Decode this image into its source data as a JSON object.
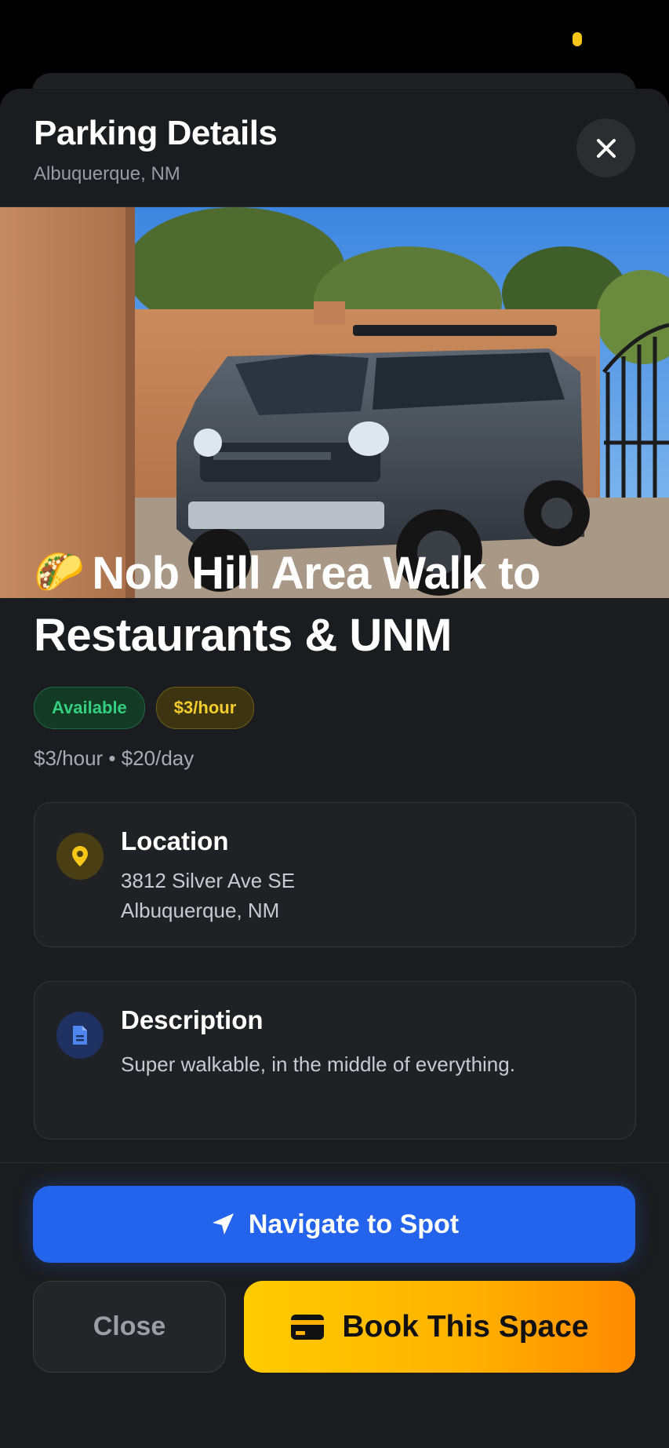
{
  "header": {
    "title": "Parking Details",
    "subtitle": "Albuquerque, NM"
  },
  "spot": {
    "emoji": "🌮",
    "name": "Nob Hill Area Walk to Restaurants & UNM",
    "badges": [
      "Available",
      "$3/hour"
    ],
    "rates": "$3/hour • $20/day"
  },
  "location": {
    "heading": "Location",
    "address_line1": "3812 Silver Ave SE",
    "address_line2": "Albuquerque, NM"
  },
  "description": {
    "heading": "Description",
    "text": "Super walkable, in the middle of everything."
  },
  "actions": {
    "navigate": "Navigate to Spot",
    "close": "Close",
    "book": "Book This Space"
  },
  "icons": [
    "close-icon",
    "location-pin-icon",
    "document-icon",
    "navigation-arrow-icon",
    "credit-card-icon"
  ],
  "colors": {
    "accent_blue": "#2463eb",
    "book_gradient_start": "#ffcc00",
    "book_gradient_end": "#ff8a00",
    "available_green": "#35d07f",
    "price_yellow": "#f5cc2e"
  }
}
